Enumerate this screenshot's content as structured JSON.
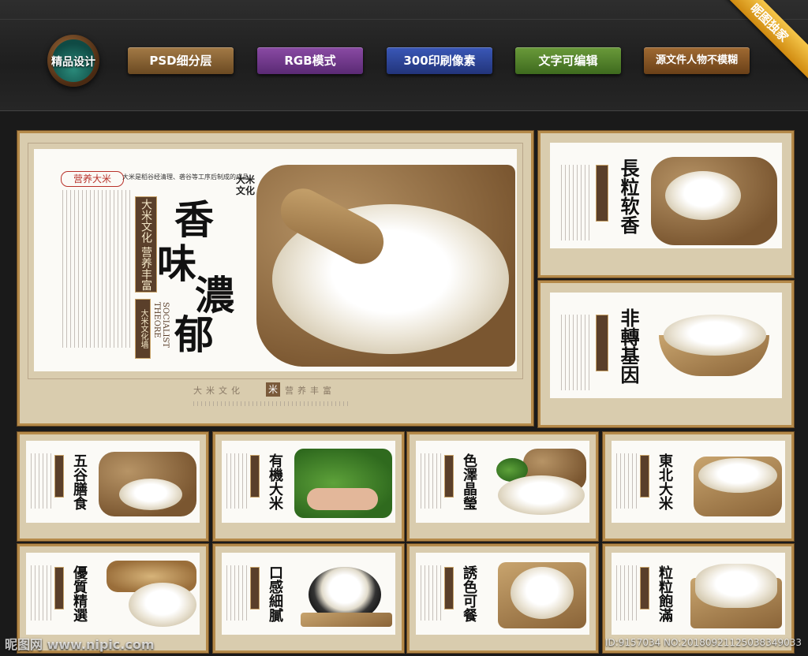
{
  "header": {
    "logo_text": "精品设计",
    "badges": [
      "PSD细分层",
      "RGB模式",
      "300印刷像素",
      "文字可编辑",
      "源文件人物不模糊"
    ],
    "corner_ribbon": "昵图独家"
  },
  "main_poster": {
    "top_seal_text": "营养大米",
    "top_caption": "大米是稻谷经清理、砻谷等工序后制成的成品。",
    "vertical_tag": "大米文化 营养丰富",
    "title_chars": [
      "香",
      "味",
      "濃",
      "郁"
    ],
    "brand_text": "大米文化",
    "side_small": "SOCIALIST THEORE",
    "sub_tag": "大米文化墙",
    "bottom_band": "大米文化",
    "bottom_band_right": "营养丰富",
    "bottom_center_seal": "米"
  },
  "side_posters": [
    {
      "title": "長粒软香"
    },
    {
      "title": "非轉基因"
    }
  ],
  "thumbnails": [
    {
      "title": "五谷膳食"
    },
    {
      "title": "有機大米"
    },
    {
      "title": "色澤晶瑩"
    },
    {
      "title": "東北大米"
    },
    {
      "title": "優質精選"
    },
    {
      "title": "口感細膩"
    },
    {
      "title": "誘色可餐"
    },
    {
      "title": "粒粒飽滿"
    }
  ],
  "footer": {
    "watermark": "昵图网 www.nipic.com",
    "id_text": "ID:9157034 NO:20180921125038349033"
  }
}
